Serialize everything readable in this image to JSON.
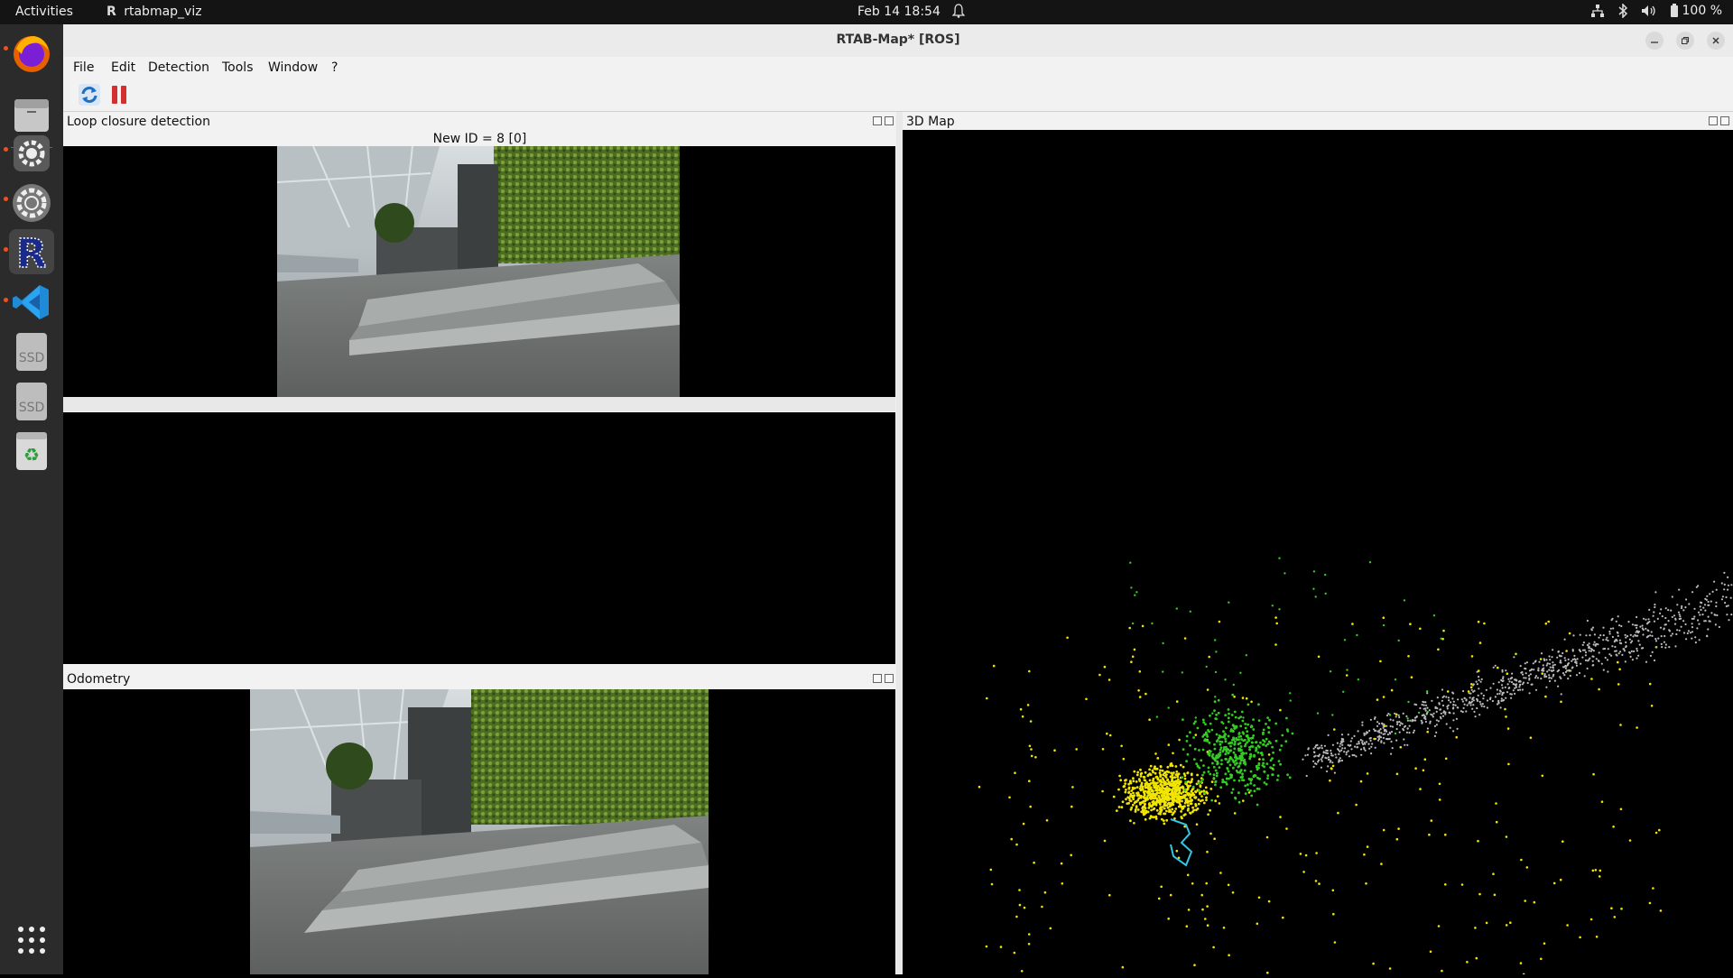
{
  "topbar": {
    "activities": "Activities",
    "app_name": "rtabmap_viz",
    "clock": "Feb 14  18:54",
    "battery": "100 %"
  },
  "dock": {
    "items": [
      "firefox-icon",
      "files-icon",
      "settings-gear-icon",
      "system-settings-icon",
      "rtabmap-icon",
      "vscode-icon",
      "ssd-drive-icon",
      "ssd-drive-icon",
      "trash-icon"
    ],
    "ssd_label": "SSD"
  },
  "window": {
    "title": "RTAB-Map* [ROS]",
    "menu": [
      "File",
      "Edit",
      "Detection",
      "Tools",
      "Window",
      "?"
    ]
  },
  "panels": {
    "loop_closure": {
      "title": "Loop closure detection",
      "caption": "New ID = 8 [0]"
    },
    "odometry": {
      "title": "Odometry"
    },
    "map3d": {
      "title": "3D Map"
    }
  },
  "colors": {
    "accent": "#e95420",
    "points_yellow": "#f2e600",
    "points_green": "#33cc22",
    "points_gray": "#bbbbbb",
    "trajectory": "#33c7e0"
  }
}
